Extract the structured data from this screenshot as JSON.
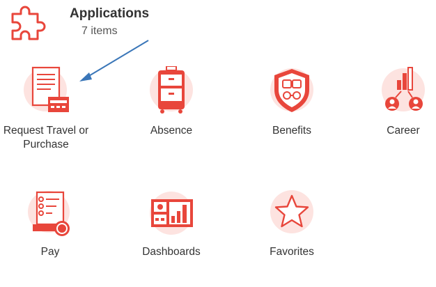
{
  "header": {
    "title": "Applications",
    "count": "7 items",
    "icon": "puzzle-icon"
  },
  "apps": [
    {
      "label": "Request Travel or Purchase",
      "icon": "document-card-icon"
    },
    {
      "label": "Absence",
      "icon": "suitcase-icon"
    },
    {
      "label": "Benefits",
      "icon": "shield-icon"
    },
    {
      "label": "Career",
      "icon": "career-growth-icon"
    },
    {
      "label": "Pay",
      "icon": "receipt-coin-icon"
    },
    {
      "label": "Dashboards",
      "icon": "dashboard-icon"
    },
    {
      "label": "Favorites",
      "icon": "star-icon"
    }
  ],
  "colors": {
    "accent": "#e8463b",
    "accent_light": "#fde3e0",
    "arrow": "#3a76b8"
  }
}
